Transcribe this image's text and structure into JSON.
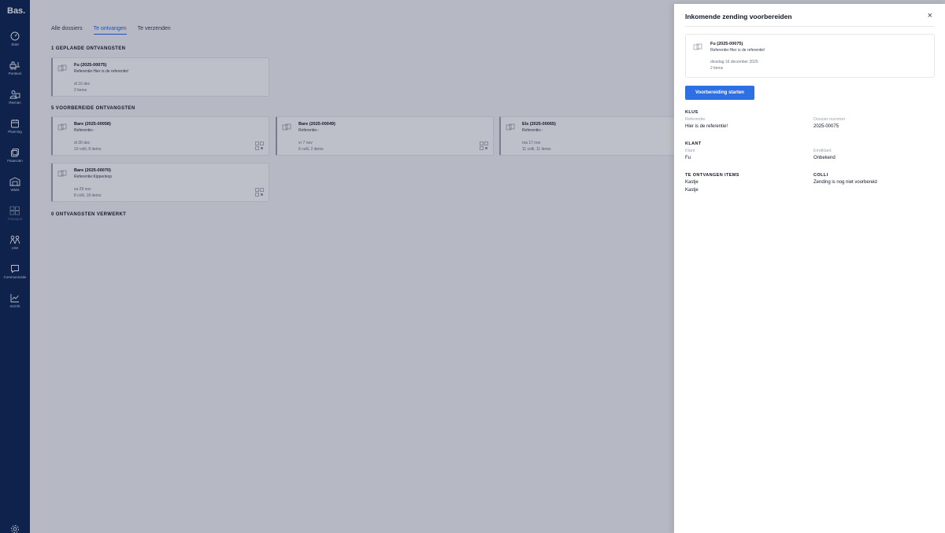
{
  "app": {
    "logo": "Bas."
  },
  "sidebar": {
    "items": [
      {
        "label": "Start",
        "icon": "gauge-icon"
      },
      {
        "label": "Ponteon",
        "icon": "forklift-icon"
      },
      {
        "label": "Rieman",
        "icon": "users-icon"
      },
      {
        "label": "Planning",
        "icon": "calendar-icon"
      },
      {
        "label": "Financiën",
        "icon": "coins-icon"
      },
      {
        "label": "WMS",
        "icon": "warehouse-icon"
      },
      {
        "label": "Transport",
        "icon": "boxes-icon"
      },
      {
        "label": "IAM",
        "icon": "people-icon"
      },
      {
        "label": "Communicatie",
        "icon": "chat-icon"
      },
      {
        "label": "Inzicht",
        "icon": "chart-icon"
      }
    ]
  },
  "tabs": [
    "Alle dossiers",
    "Te ontvangen",
    "Te verzenden"
  ],
  "sections": {
    "planned": "1 GEPLANDE ONTVANGSTEN",
    "prepared": "5 VOORBEREIDE ONTVANGSTEN",
    "processed": "0 ONTVANGSTEN VERWERKT"
  },
  "cards": {
    "planned": [
      {
        "title": "Fu (2025-00075)",
        "ref": "Referentie:Hier is de referentie!",
        "date": "di 16 dec",
        "items": "2 items"
      }
    ],
    "prepared": [
      {
        "title": "Bare (2025-00058)",
        "ref": "Referentie:-",
        "date": "di 30 dec",
        "items": "10 colli, 8 items"
      },
      {
        "title": "Bare (2025-00049)",
        "ref": "Referentie:-",
        "date": "vr 7 nov",
        "items": "6 colli, 2 items"
      },
      {
        "title": "Els (2025-00065)",
        "ref": "Referentie:-",
        "date": "ma 17 nov",
        "items": "11 colli, 11 items"
      },
      {
        "title": "Bare (2025-00070)",
        "ref": "Referentie:Kippenkop",
        "date": "za 29 nov",
        "items": "8 colli, 18 items"
      }
    ]
  },
  "panel": {
    "title": "Inkomende zending voorbereiden",
    "close": "×",
    "card": {
      "title": "Fu (2025-00075)",
      "ref": "Referentie:Hier is de referentie!",
      "date": "dinsdag 16 december 2025",
      "items": "2 items"
    },
    "button": "Voorbereiding starten",
    "klus": {
      "heading": "KLUS",
      "ref_label": "Referentie",
      "ref_value": "Hier is de referentie!",
      "dossier_label": "Dossier nummer",
      "dossier_value": "2025-00075"
    },
    "klant": {
      "heading": "KLANT",
      "klant_label": "Klant",
      "klant_value": "Fu",
      "eind_label": "Eindklant",
      "eind_value": "Onbekend"
    },
    "items": {
      "heading": "TE ONTVANGEN ITEMS",
      "values": [
        "Kastje",
        "Kastje"
      ]
    },
    "colli": {
      "heading": "COLLI",
      "value": "Zending is nog niet voorbereid"
    }
  }
}
